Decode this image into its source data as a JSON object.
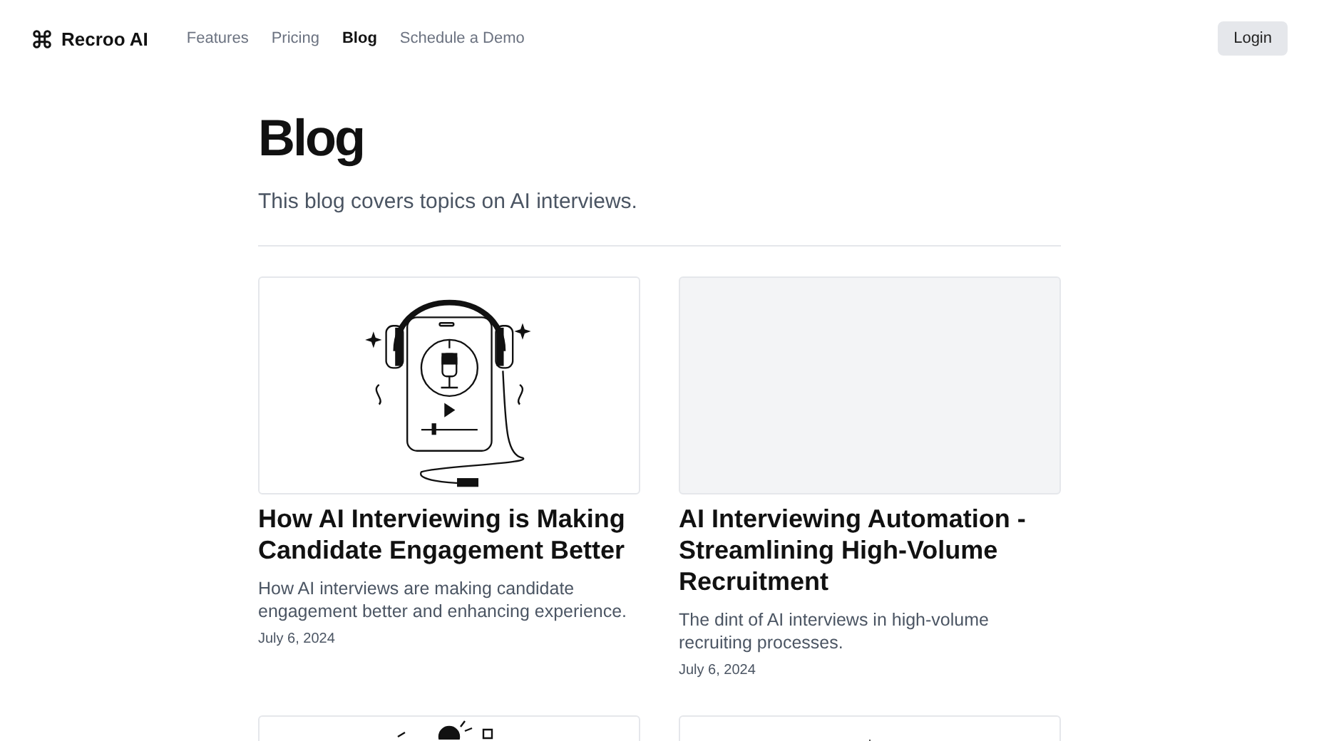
{
  "brand": "Recroo AI",
  "nav": [
    {
      "label": "Features",
      "selected": false
    },
    {
      "label": "Pricing",
      "selected": false
    },
    {
      "label": "Blog",
      "selected": true
    },
    {
      "label": "Schedule a Demo",
      "selected": false
    }
  ],
  "login": "Login",
  "heading": "Blog",
  "intro": "This blog covers topics on AI interviews.",
  "posts": [
    {
      "kind": "headphones",
      "title": "How AI Interviewing is Making Candidate Engagement Better",
      "summary": "How AI interviews are making candidate engagement better and enhancing experience.",
      "date": "July 6, 2024"
    },
    {
      "kind": "blank",
      "title": "AI Interviewing Automation - Streamlining High-Volume Recruitment",
      "summary": "The dint of AI interviews in high-volume recruiting processes.",
      "date": "July 6, 2024"
    },
    {
      "kind": "figure"
    },
    {
      "kind": "stand"
    }
  ]
}
